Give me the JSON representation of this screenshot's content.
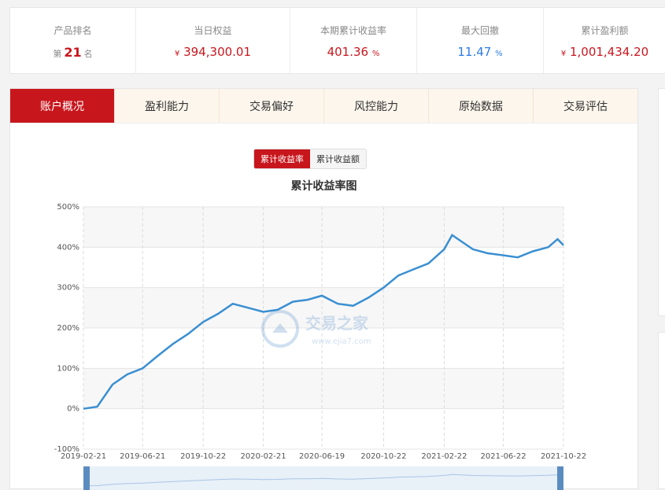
{
  "stats": {
    "rank_label": "产品排名",
    "rank_prefix": "第",
    "rank_value": "21",
    "rank_suffix": "名",
    "equity_label": "当日权益",
    "equity_currency": "¥",
    "equity_value": "394,300.01",
    "return_label": "本期累计收益率",
    "return_value": "401.36",
    "return_unit": "%",
    "drawdown_label": "最大回撤",
    "drawdown_value": "11.47",
    "drawdown_unit": "%",
    "profit_label": "累计盈利额",
    "profit_currency": "¥",
    "profit_value": "1,001,434.20"
  },
  "tabs": [
    "账户概况",
    "盈利能力",
    "交易偏好",
    "风控能力",
    "原始数据",
    "交易评估"
  ],
  "active_tab": 0,
  "toggle": {
    "option_rate": "累计收益率",
    "option_amount": "累计收益额",
    "active": "rate"
  },
  "chart_title": "累计收益率图",
  "watermark": {
    "name": "交易之家",
    "url": "www.ejia7.com"
  },
  "colors": {
    "accent": "#c8161d",
    "line": "#3a8fd1",
    "blue_value": "#2c7be5"
  },
  "chart_data": {
    "type": "line",
    "title": "累计收益率图",
    "x_tick_labels": [
      "2019-02-21",
      "2019-06-21",
      "2019-10-22",
      "2020-02-21",
      "2020-06-19",
      "2020-10-22",
      "2021-02-22",
      "2021-06-22",
      "2021-10-22"
    ],
    "y_tick_labels": [
      "-100%",
      "0%",
      "100%",
      "200%",
      "300%",
      "400%",
      "500%"
    ],
    "ylim": [
      -100,
      500
    ],
    "grid": true,
    "series": [
      {
        "x": [
          "2019-02-21",
          "2019-03-21",
          "2019-04-21",
          "2019-05-21",
          "2019-06-21",
          "2019-07-21",
          "2019-08-21",
          "2019-09-21",
          "2019-10-22",
          "2019-11-21",
          "2019-12-21",
          "2020-01-21",
          "2020-02-21",
          "2020-03-21",
          "2020-04-21",
          "2020-05-21",
          "2020-06-19",
          "2020-07-21",
          "2020-08-21",
          "2020-09-21",
          "2020-10-22",
          "2020-11-21",
          "2020-12-21",
          "2021-01-21",
          "2021-02-22",
          "2021-03-10",
          "2021-04-21",
          "2021-05-21",
          "2021-06-22",
          "2021-07-21",
          "2021-08-21",
          "2021-09-21",
          "2021-10-10",
          "2021-10-22"
        ],
        "values": [
          0,
          5,
          60,
          85,
          100,
          130,
          160,
          185,
          215,
          235,
          260,
          250,
          240,
          245,
          265,
          270,
          280,
          260,
          255,
          275,
          300,
          330,
          345,
          360,
          395,
          430,
          395,
          385,
          380,
          375,
          390,
          400,
          420,
          405
        ]
      }
    ]
  }
}
